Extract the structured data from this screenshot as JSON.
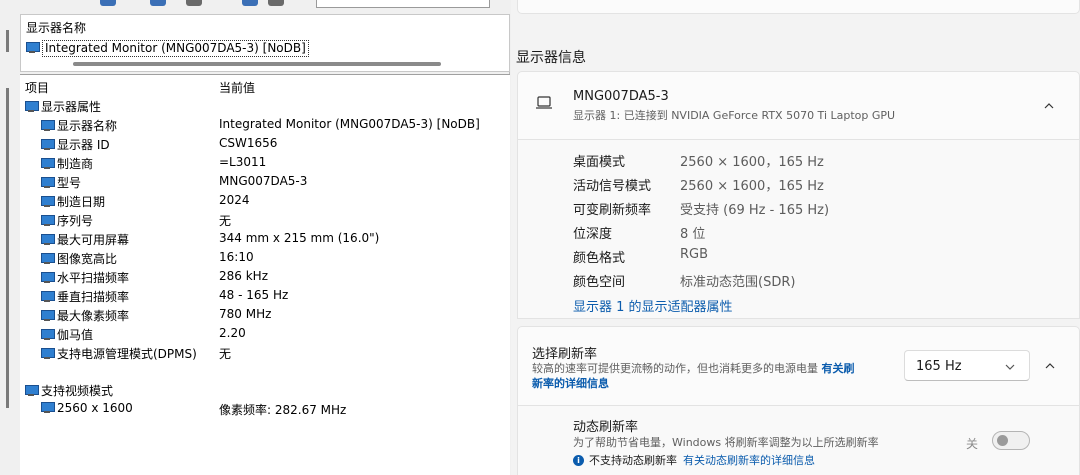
{
  "left_pane": {
    "top_box": {
      "header": "显示器名称",
      "item": "Integrated Monitor (MNG007DA5-3) [NoDB]"
    },
    "columns": {
      "item": "项目",
      "value": "当前值"
    },
    "groups": {
      "display_properties": "显示器属性",
      "video_modes": "支持视频模式"
    },
    "properties": [
      {
        "key": "显示器名称",
        "value": "Integrated Monitor (MNG007DA5-3) [NoDB]"
      },
      {
        "key": "显示器 ID",
        "value": "CSW1656"
      },
      {
        "key": "制造商",
        "value": "=L3011"
      },
      {
        "key": "型号",
        "value": "MNG007DA5-3"
      },
      {
        "key": "制造日期",
        "value": "2024"
      },
      {
        "key": "序列号",
        "value": "无"
      },
      {
        "key": "最大可用屏幕",
        "value": "344 mm x 215 mm (16.0\")"
      },
      {
        "key": "图像宽高比",
        "value": "16:10"
      },
      {
        "key": "水平扫描频率",
        "value": "286 kHz"
      },
      {
        "key": "垂直扫描频率",
        "value": "48 - 165 Hz"
      },
      {
        "key": "最大像素频率",
        "value": "780 MHz"
      },
      {
        "key": "伽马值",
        "value": "2.20"
      },
      {
        "key": "支持电源管理模式(DPMS)",
        "value": "无"
      }
    ],
    "video_mode": {
      "key": "2560 x 1600",
      "value": "像素频率: 282.67 MHz"
    }
  },
  "right_pane": {
    "section_title": "显示器信息",
    "monitor": {
      "name": "MNG007DA5-3",
      "subtitle": "显示器 1: 已连接到 NVIDIA GeForce RTX 5070 Ti Laptop GPU"
    },
    "info": [
      {
        "label": "桌面模式",
        "value": "2560 × 1600，165 Hz"
      },
      {
        "label": "活动信号模式",
        "value": "2560 × 1600，165 Hz"
      },
      {
        "label": "可变刷新频率",
        "value": "受支持 (69 Hz - 165 Hz)"
      },
      {
        "label": "位深度",
        "value": "8 位"
      },
      {
        "label": "颜色格式",
        "value": "RGB"
      },
      {
        "label": "颜色空间",
        "value": "标准动态范围(SDR)"
      }
    ],
    "adapter_link": "显示器 1 的显示适配器属性",
    "refresh": {
      "title": "选择刷新率",
      "desc": "较高的速率可提供更流畅的动作，但也消耗更多的电源电量",
      "link_part1": "有关刷",
      "link_part2": "新率的详细信息",
      "selected": "165 Hz"
    },
    "dynamic": {
      "title": "动态刷新率",
      "desc": "为了帮助节省电量，Windows 将刷新率调整为以上所选刷新率",
      "note": "不支持动态刷新率",
      "note_link": "有关动态刷新率的详细信息",
      "toggle_label": "关",
      "toggle_on": false
    },
    "colors": {
      "link": "#0b5cad",
      "icon_blue": "#2f7fd0"
    }
  }
}
